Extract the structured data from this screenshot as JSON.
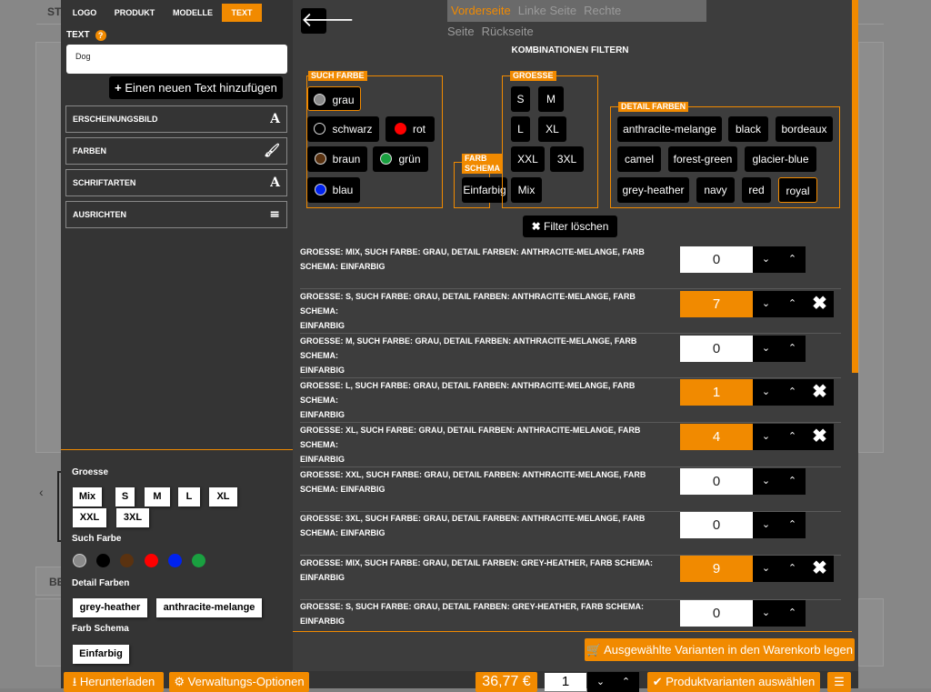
{
  "background": {
    "frag1": "STA",
    "frag2": "BE"
  },
  "left_panel": {
    "tabs": [
      "LOGO",
      "PRODUKT",
      "MODELLE",
      "TEXT"
    ],
    "text_label": "TEXT",
    "text_value": "Dog",
    "add_text_button": "Einen neuen Text hinzufügen",
    "sections": [
      {
        "label": "ERSCHEINUNGSBILD",
        "icon": "A"
      },
      {
        "label": "FARBEN",
        "icon": "brush"
      },
      {
        "label": "SCHRIFTARTEN",
        "icon": "A"
      },
      {
        "label": "AUSRICHTEN",
        "icon": "align"
      }
    ],
    "active_filters": {
      "groesse_label": "Groesse",
      "groesse": [
        "Mix",
        "S",
        "M",
        "L",
        "XL",
        "XXL",
        "3XL"
      ],
      "such_farbe_label": "Such Farbe",
      "such_farbe_colors": [
        "#8a8a8a",
        "#000000",
        "#5a3210",
        "#ff0000",
        "#0022ee",
        "#1aa040"
      ],
      "detail_farben_label": "Detail Farben",
      "detail_farben": [
        "grey-heather",
        "anthracite-melange"
      ],
      "farb_schema_label": "Farb Schema",
      "farb_schema": [
        "Einfarbig"
      ]
    }
  },
  "main": {
    "views": [
      "Vorderseite",
      "Linke Seite",
      "Rechte Seite",
      "Rückseite"
    ],
    "filter_title": "KOMBINATIONEN FILTERN",
    "such_farbe": {
      "title": "SUCH FARBE",
      "options": [
        {
          "label": "grau",
          "color": "#8a8a8a",
          "selected": true
        },
        {
          "label": "schwarz",
          "color": "#000000",
          "selected": false
        },
        {
          "label": "rot",
          "color": "#ff0000",
          "selected": false
        },
        {
          "label": "braun",
          "color": "#5a3210",
          "selected": false
        },
        {
          "label": "grün",
          "color": "#1aa040",
          "selected": false
        },
        {
          "label": "blau",
          "color": "#0022ee",
          "selected": false
        }
      ]
    },
    "farb_schema": {
      "title1": "FARB",
      "title2": "SCHEMA",
      "options": [
        "Einfarbig"
      ]
    },
    "groesse": {
      "title": "GROESSE",
      "options": [
        "S",
        "M",
        "L",
        "XL",
        "XXL",
        "3XL",
        "Mix"
      ]
    },
    "detail_farben": {
      "title": "DETAIL FARBEN",
      "options": [
        "anthracite-melange",
        "black",
        "bordeaux",
        "camel",
        "forest-green",
        "glacier-blue",
        "grey-heather",
        "navy",
        "red",
        "royal"
      ],
      "selected": "royal"
    },
    "clear_filter": "Filter löschen",
    "variants": [
      {
        "line1": "GROESSE: MIX, SUCH FARBE: GRAU, DETAIL FARBEN: ANTHRACITE-MELANGE, FARB",
        "line2": "SCHEMA: EINFARBIG",
        "qty": "0",
        "active": false
      },
      {
        "line1": "GROESSE: S, SUCH FARBE: GRAU, DETAIL FARBEN: ANTHRACITE-MELANGE, FARB SCHEMA:",
        "line2": "EINFARBIG",
        "qty": "7",
        "active": true
      },
      {
        "line1": "GROESSE: M, SUCH FARBE: GRAU, DETAIL FARBEN: ANTHRACITE-MELANGE, FARB SCHEMA:",
        "line2": "EINFARBIG",
        "qty": "0",
        "active": false
      },
      {
        "line1": "GROESSE: L, SUCH FARBE: GRAU, DETAIL FARBEN: ANTHRACITE-MELANGE, FARB SCHEMA:",
        "line2": "EINFARBIG",
        "qty": "1",
        "active": true
      },
      {
        "line1": "GROESSE: XL, SUCH FARBE: GRAU, DETAIL FARBEN: ANTHRACITE-MELANGE, FARB SCHEMA:",
        "line2": "EINFARBIG",
        "qty": "4",
        "active": true
      },
      {
        "line1": "GROESSE: XXL, SUCH FARBE: GRAU, DETAIL FARBEN: ANTHRACITE-MELANGE, FARB",
        "line2": "SCHEMA: EINFARBIG",
        "qty": "0",
        "active": false
      },
      {
        "line1": "GROESSE: 3XL, SUCH FARBE: GRAU, DETAIL FARBEN: ANTHRACITE-MELANGE, FARB",
        "line2": "SCHEMA: EINFARBIG",
        "qty": "0",
        "active": false
      },
      {
        "line1": "GROESSE: MIX, SUCH FARBE: GRAU, DETAIL FARBEN: GREY-HEATHER, FARB SCHEMA:",
        "line2": "EINFARBIG",
        "qty": "9",
        "active": true
      },
      {
        "line1": "GROESSE: S, SUCH FARBE: GRAU, DETAIL FARBEN: GREY-HEATHER, FARB SCHEMA:",
        "line2": "EINFARBIG",
        "qty": "0",
        "active": false
      }
    ],
    "cart_button": "Ausgewählte Varianten in den Warenkorb legen"
  },
  "bottom": {
    "download": "Herunterladen",
    "admin_options": "Verwaltungs-Optionen",
    "price": "36,77 €",
    "quantity": "1",
    "select_variants": "Produktvarianten auswählen"
  },
  "colors": {
    "accent": "#f18a00",
    "panel": "#343434",
    "main": "#3d3d3d"
  }
}
